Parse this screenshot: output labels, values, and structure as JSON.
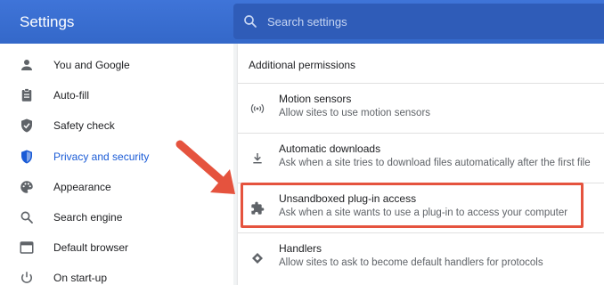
{
  "app": {
    "title": "Settings"
  },
  "search": {
    "placeholder": "Search settings",
    "value": ""
  },
  "sidebar": {
    "items": [
      {
        "label": "You and Google",
        "icon": "person-icon",
        "active": false
      },
      {
        "label": "Auto-fill",
        "icon": "clipboard-icon",
        "active": false
      },
      {
        "label": "Safety check",
        "icon": "shield-check-icon",
        "active": false
      },
      {
        "label": "Privacy and security",
        "icon": "shield-icon",
        "active": true
      },
      {
        "label": "Appearance",
        "icon": "palette-icon",
        "active": false
      },
      {
        "label": "Search engine",
        "icon": "search-icon",
        "active": false
      },
      {
        "label": "Default browser",
        "icon": "browser-icon",
        "active": false
      },
      {
        "label": "On start-up",
        "icon": "power-icon",
        "active": false
      }
    ]
  },
  "main": {
    "section_title": "Additional permissions",
    "permissions": [
      {
        "title": "Motion sensors",
        "desc": "Allow sites to use motion sensors",
        "icon": "motion-sensor-icon"
      },
      {
        "title": "Automatic downloads",
        "desc": "Ask when a site tries to download files automatically after the first file",
        "icon": "download-icon"
      },
      {
        "title": "Unsandboxed plug-in access",
        "desc": "Ask when a site wants to use a plug-in to access your computer",
        "icon": "puzzle-icon",
        "highlighted": true
      },
      {
        "title": "Handlers",
        "desc": "Allow sites to ask to become default handlers for protocols",
        "icon": "handler-icon"
      }
    ]
  },
  "colors": {
    "header": "#3a6fd4",
    "accent": "#1a5bd6",
    "highlight": "#e5533e"
  }
}
